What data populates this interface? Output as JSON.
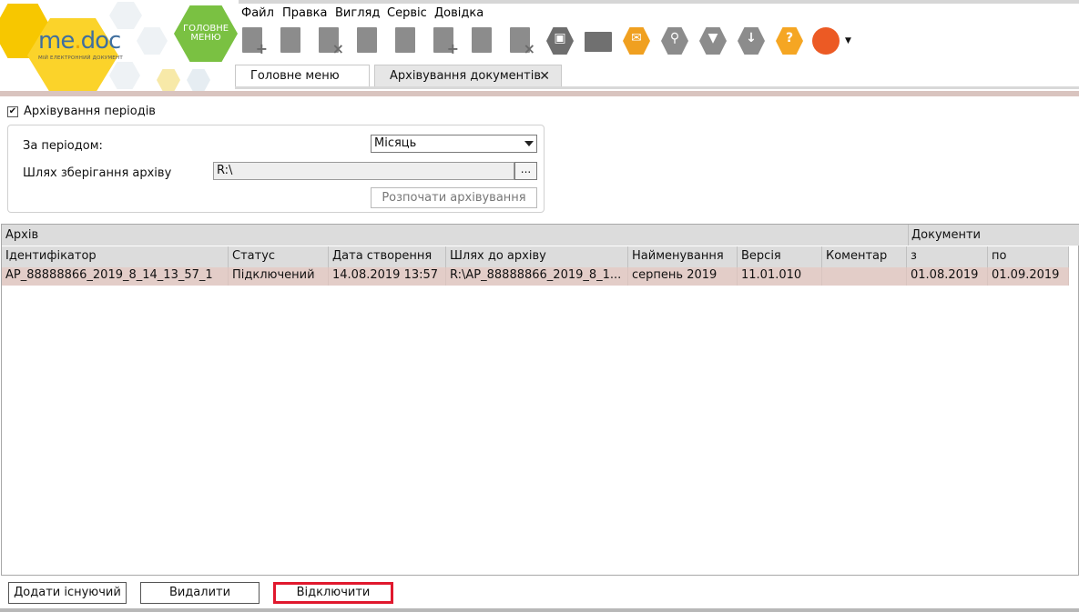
{
  "app": {
    "logo": {
      "me": "me",
      "doc": "doc",
      "tagline": "МІЙ ЕЛЕКТРОННИЙ ДОКУМЕНТ"
    },
    "main_menu_button": {
      "line1": "ГОЛОВНЕ",
      "line2": "МЕНЮ"
    },
    "menu": [
      "Файл",
      "Правка",
      "Вигляд",
      "Сервіс",
      "Довідка"
    ],
    "tabs": [
      {
        "label": "Головне меню"
      },
      {
        "label": "Архівування документів",
        "close": "✕"
      }
    ]
  },
  "settings": {
    "checkbox_checked": true,
    "checkbox_mark": "✔",
    "checkbox_label": "Архівування періодів",
    "period_label": "За періодом:",
    "period_value": "Місяць",
    "path_label": "Шлях зберігання архіву",
    "path_value": "R:\\",
    "browse_label": "...",
    "start_button": "Розпочати архівування"
  },
  "grid": {
    "group_headers": {
      "archive": "Архів",
      "documents": "Документи"
    },
    "columns": [
      "Ідентифікатор",
      "Статус",
      "Дата створення",
      "Шлях до архіву",
      "Найменування",
      "Версія",
      "Коментар",
      "з",
      "по"
    ],
    "rows": [
      {
        "id": "AP_88888866_2019_8_14_13_57_1",
        "status": "Підключений",
        "created": "14.08.2019 13:57",
        "path": "R:\\AP_88888866_2019_8_1...",
        "name": "серпень 2019",
        "version": "11.01.010",
        "comment": "",
        "from": "01.08.2019",
        "to": "01.09.2019"
      }
    ]
  },
  "buttons": {
    "add_existing": "Додати існуючий",
    "delete": "Видалити",
    "disconnect": "Відключити"
  },
  "colors": {
    "accent_green": "#7ac142",
    "logo_yellow": "#f7c700",
    "selected_row": "#e3cdc8",
    "highlight_border": "#e0182d"
  }
}
